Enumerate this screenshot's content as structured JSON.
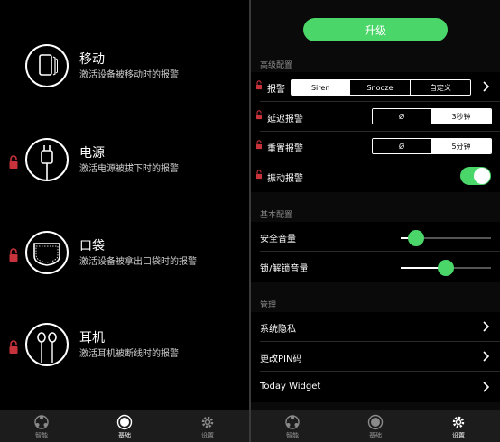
{
  "left": {
    "modes": [
      {
        "title": "移动",
        "desc": "激活设备被移动时的报警",
        "icon": "phone-motion-icon",
        "locked": false
      },
      {
        "title": "电源",
        "desc": "激活电源被拔下时的报警",
        "icon": "charger-plug-icon",
        "locked": true
      },
      {
        "title": "口袋",
        "desc": "激活设备被拿出口袋时的报警",
        "icon": "pocket-icon",
        "locked": true
      },
      {
        "title": "耳机",
        "desc": "激活耳机被断线时的报警",
        "icon": "earphones-icon",
        "locked": true
      }
    ],
    "tabbar": {
      "tabs": [
        {
          "label": "智能",
          "icon": "smart-icon"
        },
        {
          "label": "基础",
          "icon": "basic-icon",
          "active": true
        },
        {
          "label": "设置",
          "icon": "settings-gear-icon"
        }
      ]
    }
  },
  "right": {
    "upgrade_label": "升级",
    "advanced": {
      "title": "高级配置",
      "alarm": {
        "label": "报警",
        "options": [
          "Siren",
          "Snooze",
          "自定义"
        ],
        "selected": "Siren"
      },
      "delay": {
        "label": "延迟报警",
        "options": [
          "Ø",
          "3秒钟"
        ],
        "selected": "3秒钟"
      },
      "reset": {
        "label": "重置报警",
        "options": [
          "Ø",
          "5分钟"
        ],
        "selected": "5分钟"
      },
      "vibrate": {
        "label": "振动报警",
        "on": true
      }
    },
    "basic": {
      "title": "基本配置",
      "volume": {
        "label": "安全音量",
        "value": 0.17
      },
      "unlock_volume": {
        "label": "锁/解锁音量",
        "value": 0.5
      }
    },
    "manage": {
      "title": "管理",
      "items": [
        "系统隐私",
        "更改PIN码",
        "Today Widget"
      ]
    },
    "tabbar": {
      "tabs": [
        {
          "label": "智能",
          "icon": "smart-icon"
        },
        {
          "label": "基础",
          "icon": "basic-icon"
        },
        {
          "label": "设置",
          "icon": "settings-gear-icon",
          "active": true
        }
      ]
    }
  },
  "colors": {
    "accent": "#4bd66a",
    "lock": "#c8323a",
    "background": "#000000"
  }
}
